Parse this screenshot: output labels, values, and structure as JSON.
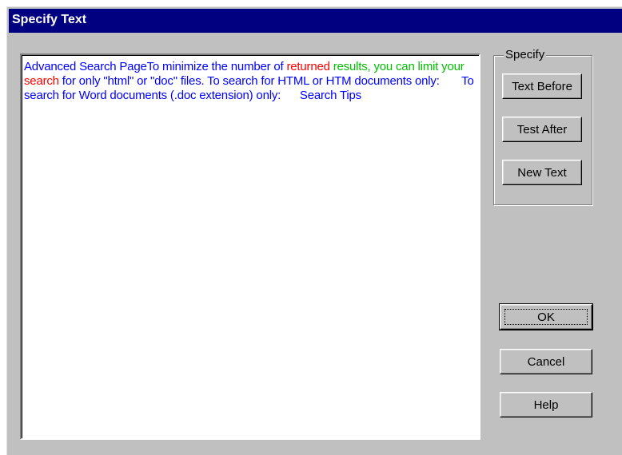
{
  "window": {
    "title": "Specify Text"
  },
  "textbox": {
    "segments": [
      {
        "text": "Advanced Search PageTo minimize the number of ",
        "color": "#0000ff"
      },
      {
        "text": "returned",
        "color": "#ff0000"
      },
      {
        "text": " results, you can limit your",
        "color": "#00c000"
      },
      {
        "text": " search",
        "color": "#ff0000"
      },
      {
        "text": " for only \"html\" or \"doc\" files. To search for HTML or HTM documents only:       To search for Word documents (.doc extension) only:      Search Tips",
        "color": "#0000ff"
      }
    ]
  },
  "specify_group": {
    "label": "Specify",
    "buttons": {
      "text_before": "Text Before",
      "test_after": "Test After",
      "new_text": "New Text"
    }
  },
  "actions": {
    "ok": "OK",
    "cancel": "Cancel",
    "help": "Help"
  }
}
